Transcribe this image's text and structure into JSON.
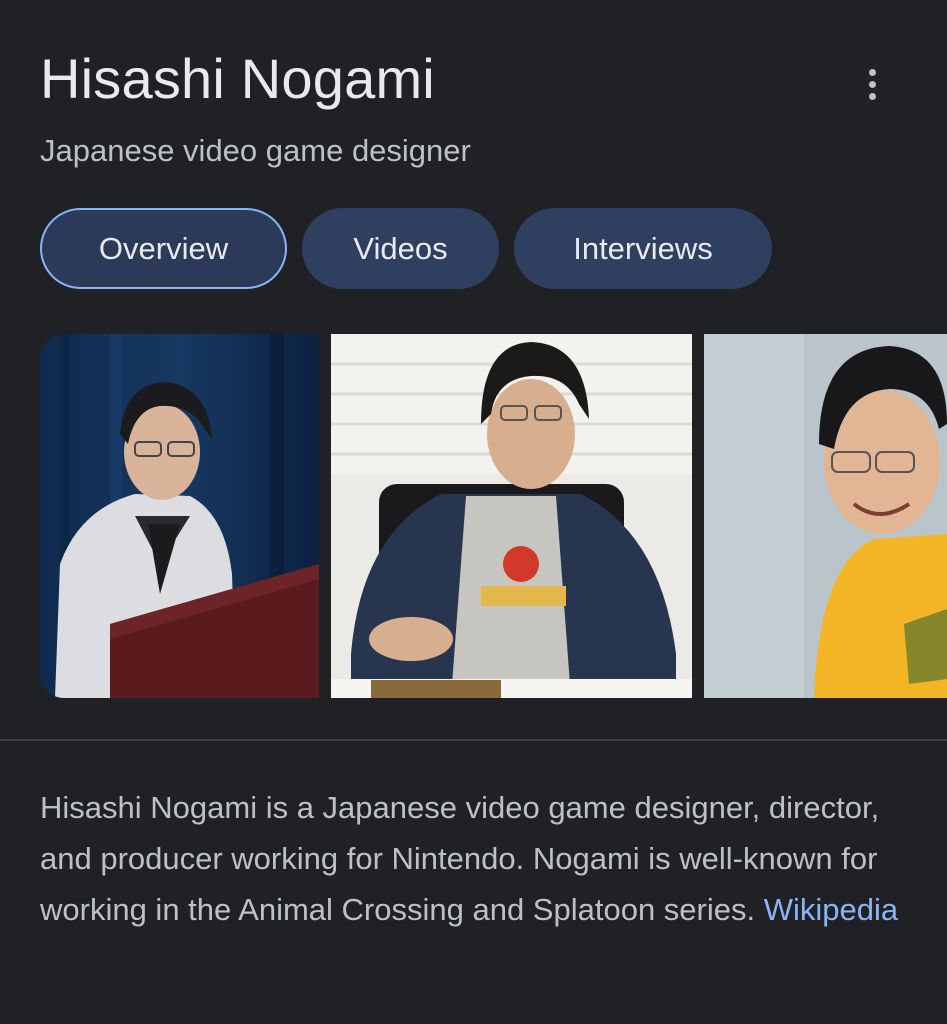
{
  "entity": {
    "name": "Hisashi Nogami",
    "subtitle": "Japanese video game designer"
  },
  "menu": {
    "icon": "more-vert-icon"
  },
  "tabs": [
    {
      "label": "Overview",
      "active": true
    },
    {
      "label": "Videos",
      "active": false
    },
    {
      "label": "Interviews",
      "active": false
    }
  ],
  "description": {
    "text": "Hisashi Nogami is a Japanese video game designer, director, and producer working for Nintendo. Nogami is well-known for working in the Animal Crossing and Splatoon series.",
    "source_link": "Wikipedia"
  },
  "colors": {
    "background": "#202124",
    "tab_background": "#2f3f5f",
    "active_tab_border": "#8ab4f8",
    "link": "#8ab4f8"
  }
}
